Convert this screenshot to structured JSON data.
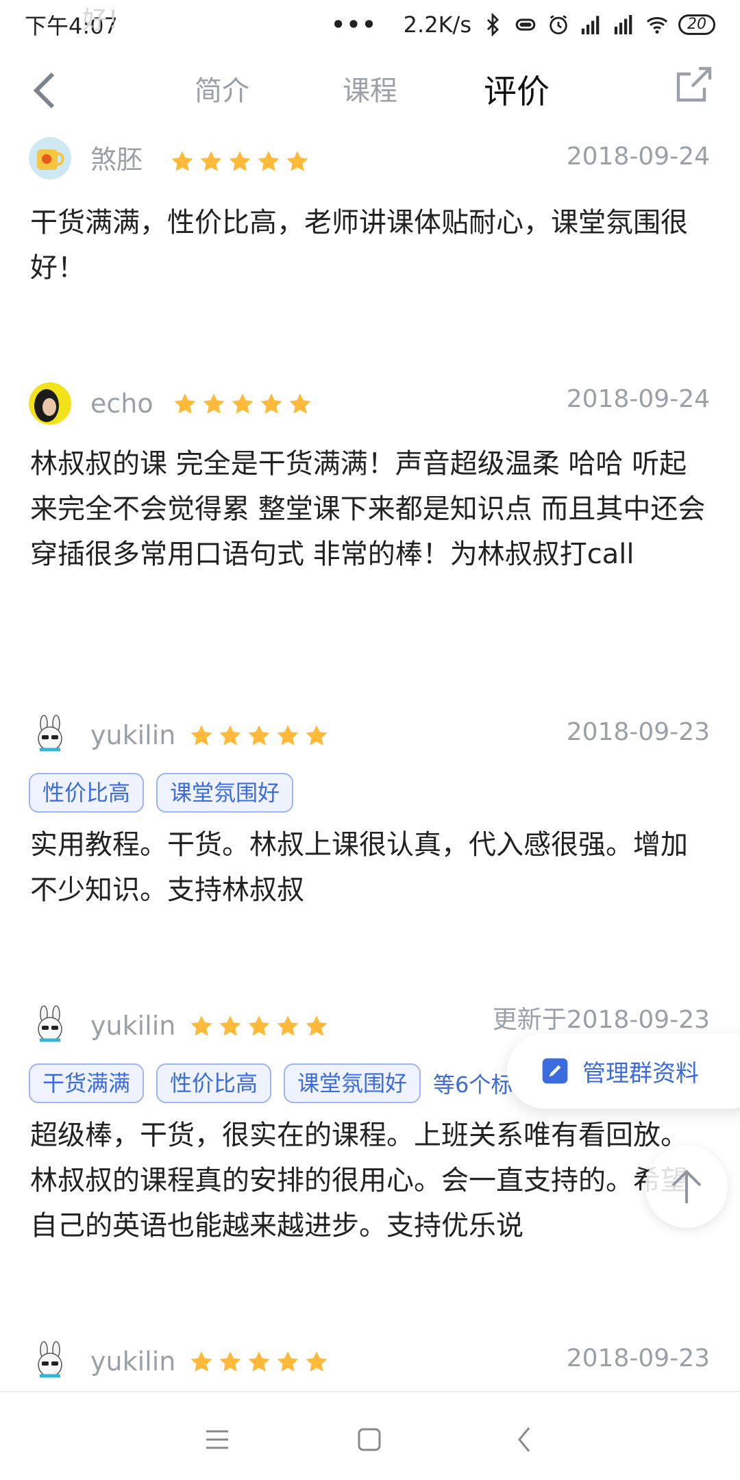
{
  "status_bar": {
    "time": "下午4:07",
    "ghost_text": "好！",
    "more_dots": "•••",
    "network_speed": "2.2K/s",
    "battery": "20"
  },
  "nav": {
    "tabs": [
      {
        "label": "简介",
        "active": false
      },
      {
        "label": "课程",
        "active": false
      },
      {
        "label": "评价",
        "active": true
      }
    ]
  },
  "reviews": [
    {
      "username": "煞胚",
      "rating": 5,
      "date": "2018-09-24",
      "tags": [],
      "content": "干货满满，性价比高，老师讲课体贴耐心，课堂氛围很好！"
    },
    {
      "username": "echo",
      "rating": 5,
      "date": "2018-09-24",
      "tags": [],
      "content": "林叔叔的课 完全是干货满满！声音超级温柔 哈哈 听起来完全不会觉得累 整堂课下来都是知识点 而且其中还会穿插很多常用口语句式 非常的棒！为林叔叔打call"
    },
    {
      "username": "yukilin",
      "rating": 5,
      "date": "2018-09-23",
      "tags": [
        "性价比高",
        "课堂氛围好"
      ],
      "content": "实用教程。干货。林叔上课很认真，代入感很强。增加不少知识。支持林叔叔"
    },
    {
      "username": "yukilin",
      "rating": 5,
      "date": "更新于2018-09-23",
      "tags": [
        "干货满满",
        "性价比高",
        "课堂氛围好"
      ],
      "tags_more": "等6个标",
      "content": "超级棒，干货，很实在的课程。上班关系唯有看回放。林叔叔的课程真的安排的很用心。会一直支持的。希望自己的英语也能越来越进步。支持优乐说"
    },
    {
      "username": "yukilin",
      "rating": 5,
      "date": "2018-09-23",
      "tags": [],
      "content": ""
    }
  ],
  "floating": {
    "manage_label": "管理群资料"
  },
  "colors": {
    "accent": "#3b6bdd",
    "star": "#ffb93b",
    "muted": "#9aa0a8"
  }
}
